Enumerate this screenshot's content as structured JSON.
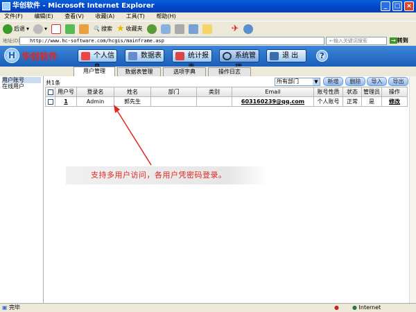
{
  "window": {
    "title": "华创软件 - Microsoft Internet Explorer"
  },
  "menu": [
    "文件(F)",
    "编辑(E)",
    "查看(V)",
    "收藏(A)",
    "工具(T)",
    "帮助(H)"
  ],
  "toolbar": {
    "back": "后退",
    "search": "搜索",
    "favorites": "收藏夹"
  },
  "address": {
    "label": "地址(D)",
    "url": "http://www.hc-software.com/hcgis/mainframe.asp",
    "search_placeholder": "←输入关键词搜索",
    "go": "转到"
  },
  "app": {
    "logo": "华创软件",
    "nav": [
      "个人信息",
      "数据表",
      "统计报表",
      "系统管理",
      "退 出"
    ],
    "help": "?"
  },
  "tabs": [
    "用户管理",
    "数据表管理",
    "选项字典",
    "操作日志"
  ],
  "sidebar": [
    "用户账号",
    "在线用户"
  ],
  "main": {
    "count": "共1条",
    "dept": "所有部门",
    "actions": [
      "新增",
      "删除",
      "导入",
      "导出"
    ],
    "columns": [
      "用户号",
      "登录名",
      "姓名",
      "部门",
      "类别",
      "Email",
      "账号性质",
      "状态",
      "管理员",
      "操作"
    ],
    "rows": [
      [
        "1",
        "Admin",
        "郭先生",
        "",
        "",
        "603160239@qq.com",
        "个人账号",
        "正常",
        "是",
        "修改"
      ]
    ]
  },
  "annotation": "支持多用户访问，各用户凭密码登录。",
  "status": {
    "text": "完毕",
    "zone": "Internet"
  }
}
